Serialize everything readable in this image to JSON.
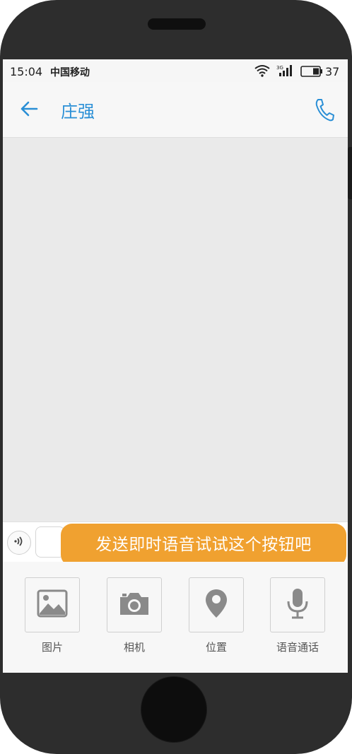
{
  "status_bar": {
    "time": "15:04",
    "carrier": "中国移动",
    "network": "3G",
    "battery": "37"
  },
  "header": {
    "title": "庄强",
    "back_icon": "arrow-left-icon",
    "call_icon": "phone-icon"
  },
  "input_bar": {
    "voice_icon": "sound-wave-icon",
    "message_value": ""
  },
  "tooltip": {
    "text": "发送即时语音试试这个按钮吧"
  },
  "tools": [
    {
      "label": "图片",
      "icon": "image-icon"
    },
    {
      "label": "相机",
      "icon": "camera-icon"
    },
    {
      "label": "位置",
      "icon": "location-pin-icon"
    },
    {
      "label": "语音通话",
      "icon": "microphone-icon"
    }
  ],
  "colors": {
    "accent": "#2a8fd6",
    "tooltip": "#f0a130",
    "chat_bg": "#eaeaea",
    "frame": "#2d2d2d"
  }
}
